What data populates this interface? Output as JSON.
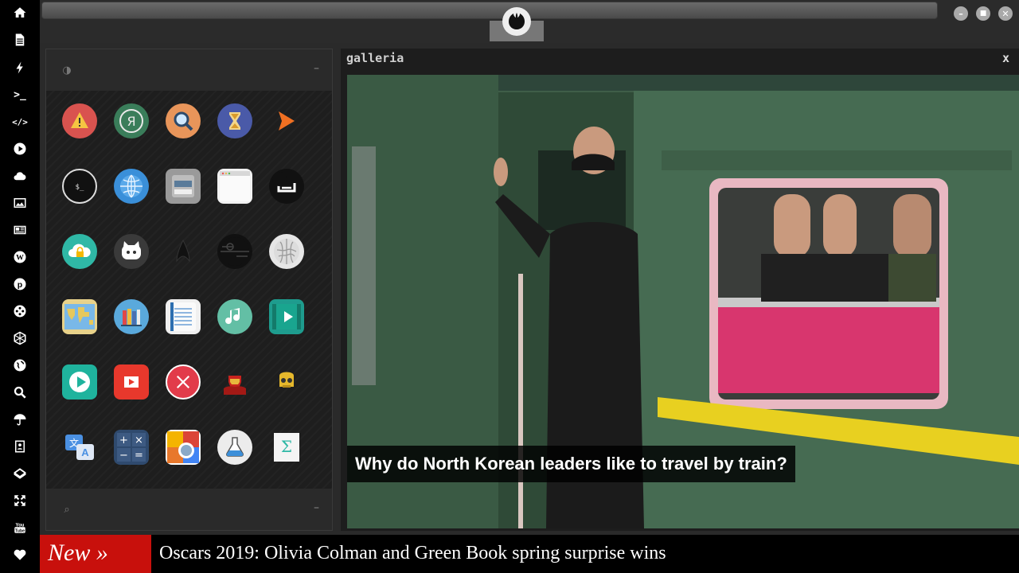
{
  "dock": {
    "items": [
      "home",
      "document",
      "flash",
      "terminal",
      "code",
      "play",
      "cloud",
      "image",
      "news",
      "wordpress",
      "pinterest",
      "film-reel",
      "network",
      "globe",
      "search",
      "umbrella",
      "contacts",
      "codepen",
      "expand",
      "youtube",
      "heart"
    ]
  },
  "topbar": {
    "window_controls": [
      "minimize",
      "maximize",
      "close"
    ],
    "window_control_glyphs": [
      "–",
      "■",
      "✕"
    ]
  },
  "launcher": {
    "header_icon": "◑",
    "footer_icon": "⌕",
    "minimize_glyph": "–",
    "apps": [
      [
        "warning",
        "yandex",
        "search",
        "hourglass",
        "arrow-right"
      ],
      [
        "terminal",
        "globe",
        "scanner",
        "window",
        "stackoverflow"
      ],
      [
        "cloud-lock",
        "github",
        "startrek",
        "death-star",
        "wikipedia"
      ],
      [
        "world-map",
        "books",
        "notebook",
        "music",
        "video-player"
      ],
      [
        "play-store",
        "photo-booth",
        "close",
        "iron-man",
        "c3po"
      ],
      [
        "translate",
        "calculator",
        "color-picker",
        "chemistry",
        "math"
      ]
    ]
  },
  "galleria": {
    "title": "galleria",
    "close_label": "x",
    "caption": "Why do North Korean leaders like to travel by train?"
  },
  "ticker": {
    "badge": "New »",
    "headline": "Oscars 2019: Olivia Colman and Green Book spring surprise wins"
  },
  "colors": {
    "ticker_badge": "#c8100c",
    "dock_bg": "#000000",
    "panel_bg": "#1c1c1c"
  }
}
